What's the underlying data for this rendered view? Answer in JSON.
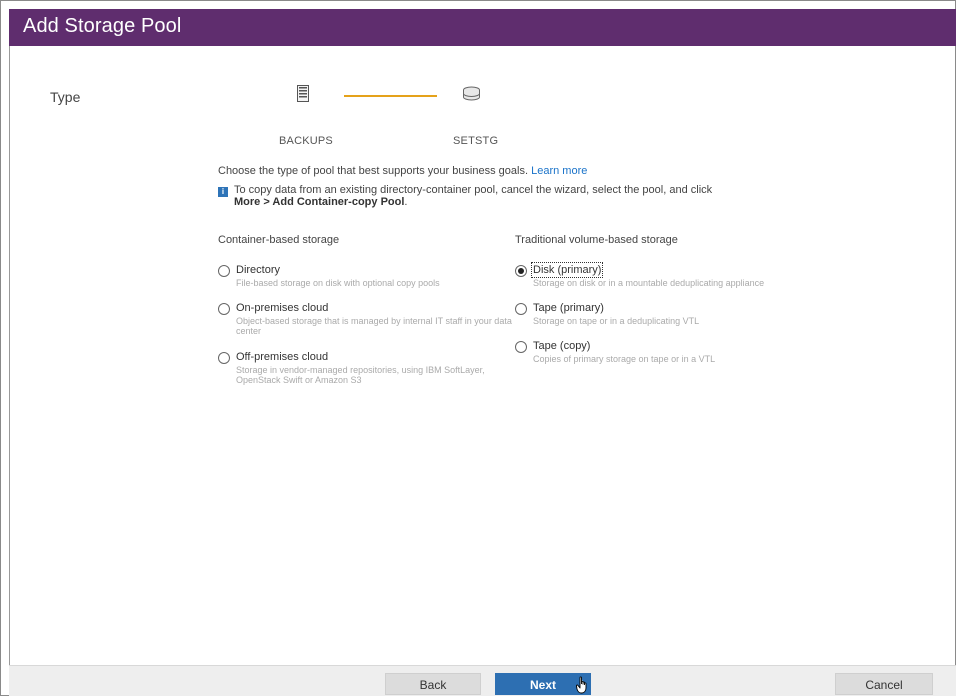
{
  "dialog": {
    "title": "Add Storage Pool"
  },
  "wizard": {
    "current_step_label": "Type",
    "steps": [
      {
        "name": "BACKUPS",
        "icon": "server-icon"
      },
      {
        "name": "SETSTG",
        "icon": "storage-pool-icon"
      }
    ]
  },
  "intro": {
    "text": "Choose the type of pool that best supports your business goals.",
    "link": "Learn more"
  },
  "info": {
    "prefix": "To copy data from an existing directory-container pool, cancel the wizard, select the pool, and click ",
    "bold": "More > Add Container-copy Pool",
    "suffix": "."
  },
  "container_storage": {
    "heading": "Container-based storage",
    "options": [
      {
        "label": "Directory",
        "desc": "File-based storage on disk with optional copy pools",
        "selected": false
      },
      {
        "label": "On-premises cloud",
        "desc": "Object-based storage that is managed by internal IT staff in your data center",
        "selected": false
      },
      {
        "label": "Off-premises cloud",
        "desc": "Storage in vendor-managed repositories, using IBM SoftLayer, OpenStack Swift or Amazon S3",
        "selected": false
      }
    ]
  },
  "traditional_storage": {
    "heading": "Traditional volume-based storage",
    "options": [
      {
        "label": "Disk (primary)",
        "desc": "Storage on disk or in a mountable deduplicating appliance",
        "selected": true
      },
      {
        "label": "Tape (primary)",
        "desc": "Storage on tape or in a deduplicating VTL",
        "selected": false
      },
      {
        "label": "Tape (copy)",
        "desc": "Copies of primary storage on tape or in a VTL",
        "selected": false
      }
    ]
  },
  "footer": {
    "back_label": "Back",
    "next_label": "Next",
    "cancel_label": "Cancel"
  },
  "colors": {
    "title_bar": "#5f2d6e",
    "stepper_line": "#e5a21a",
    "primary_button": "#2d6fb2",
    "link": "#1a73c9"
  }
}
